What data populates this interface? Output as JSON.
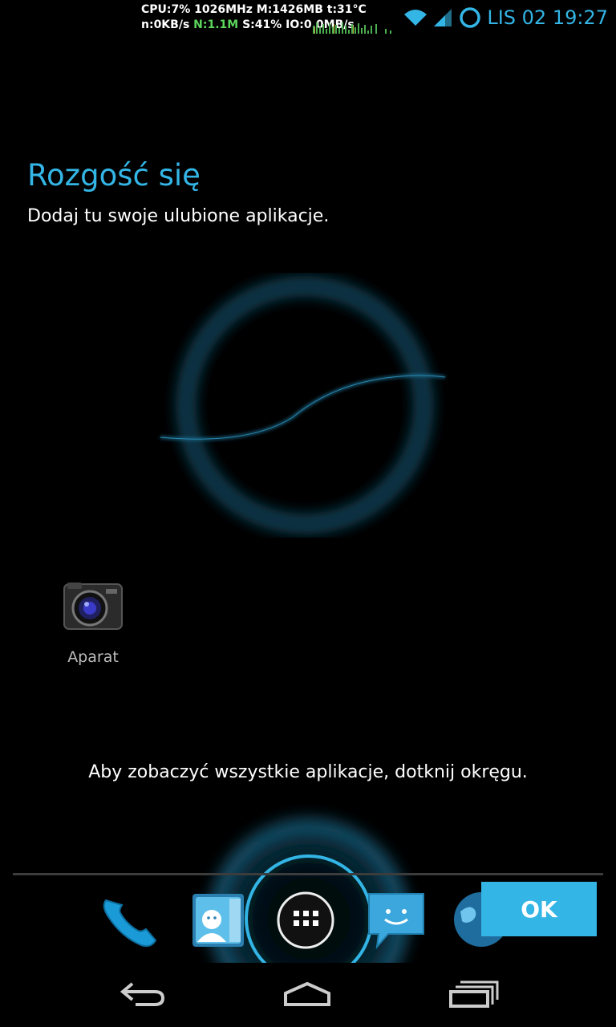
{
  "status_bar": {
    "stats_line1": "CPU:7% 1026MHz M:1426MB t:31°C",
    "stats_line2_a": "n:0KB/s ",
    "stats_line2_b": "N:1.1M",
    "stats_line2_c": " S:41% IO:0.0MB/s",
    "clock": "LIS 02 19:27",
    "icons": [
      "wifi-icon",
      "signal-icon",
      "loading-icon"
    ]
  },
  "welcome": {
    "title": "Rozgość się",
    "subtitle": "Dodaj tu swoje ulubione aplikacje."
  },
  "desktop_app": {
    "label": "Aparat",
    "icon": "camera-icon"
  },
  "hint": "Aby zobaczyć wszystkie aplikacje, dotknij okręgu.",
  "dock": {
    "icons": [
      "phone-icon",
      "contacts-icon",
      "all-apps-icon",
      "messaging-icon",
      "browser-icon"
    ]
  },
  "ok_button": "OK",
  "nav": [
    "back-icon",
    "home-icon",
    "recents-icon"
  ],
  "colors": {
    "accent": "#33b5e5",
    "background": "#000000"
  }
}
